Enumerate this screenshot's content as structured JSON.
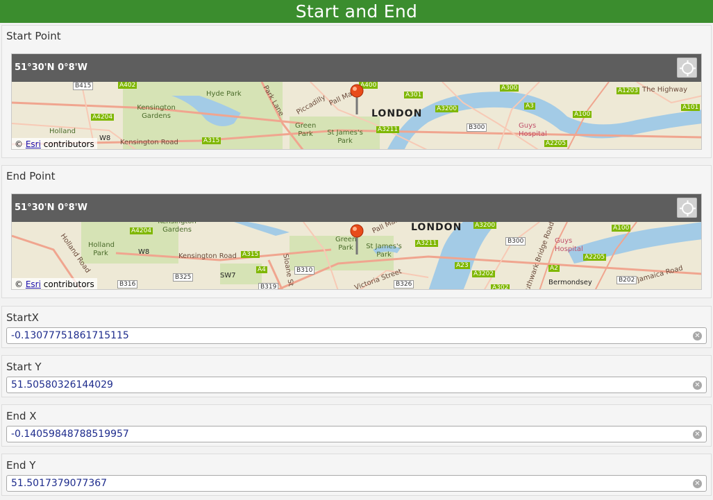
{
  "header": {
    "title": "Start and End"
  },
  "start_point": {
    "label": "Start Point",
    "coordinate_readout": "51°30'N 0°8'W",
    "attribution": {
      "prefix": "©",
      "link": "Esri",
      "suffix": "contributors"
    },
    "map_labels": [
      "LONDON",
      "Hyde Park",
      "Kensington Gardens",
      "Green Park",
      "St James's Park",
      "Pall Mall",
      "Piccadilly",
      "Park Lane",
      "Kensington Road",
      "Holland",
      "W8",
      "Guys Hospital",
      "The Highway",
      "B415",
      "A402",
      "A4204",
      "A315",
      "A400",
      "A301",
      "A3200",
      "A3211",
      "B300",
      "A300",
      "A3",
      "A100",
      "A1203",
      "A101",
      "A2205"
    ]
  },
  "end_point": {
    "label": "End Point",
    "coordinate_readout": "51°30'N 0°8'W",
    "attribution": {
      "prefix": "©",
      "link": "Esri",
      "suffix": "contributors"
    },
    "map_labels": [
      "LONDON",
      "Kensington Gardens",
      "Holland Park",
      "Holland Road",
      "W8",
      "Kensington Road",
      "SW7",
      "Green Park",
      "St James's Park",
      "Pall Mall",
      "Victoria Street",
      "Southwark Bridge Road",
      "Guys Hospital",
      "Jamaica Road",
      "Bermondsey",
      "Sloane St",
      "A4204",
      "A315",
      "A4",
      "B325",
      "B310",
      "B319",
      "B316",
      "B326",
      "A3211",
      "A3200",
      "B300",
      "A23",
      "A3202",
      "A302",
      "A2",
      "A100",
      "A2205",
      "B202"
    ]
  },
  "fields": [
    {
      "label": "StartX",
      "value": "-0.13077751861715115"
    },
    {
      "label": "Start Y",
      "value": "51.50580326144029"
    },
    {
      "label": "End X",
      "value": "-0.14059848788519957"
    },
    {
      "label": "End Y",
      "value": "51.5017379077367"
    }
  ],
  "icons": {
    "locate": "crosshair-locate-icon",
    "marker": "map-pin-icon",
    "clear": "clear-x-icon"
  },
  "colors": {
    "header": "#3b8d2e",
    "coord_bar": "#5e5e5e",
    "value_text": "#1d2b8c",
    "road_badge": "#7fb700"
  }
}
